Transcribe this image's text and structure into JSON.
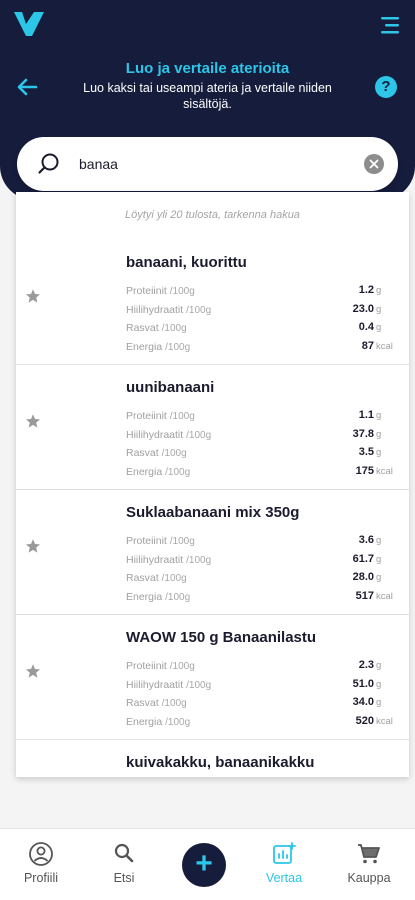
{
  "header": {
    "title": "Luo ja vertaile aterioita",
    "subtitle": "Luo kaksi tai useampi ateria ja vertaile niiden sisältöjä.",
    "help_label": "?"
  },
  "search": {
    "value": "banaa",
    "hint": "Löytyi yli 20 tulosta, tarkenna hakua"
  },
  "nutrient_labels": {
    "protein": "Proteiinit",
    "carbs": "Hiilihydraatit",
    "fat": "Rasvat",
    "energy": "Energia",
    "per": "/100g"
  },
  "results": [
    {
      "name": "banaani, kuorittu",
      "protein": "1.2",
      "carbs": "23.0",
      "fat": "0.4",
      "energy": "87"
    },
    {
      "name": "uunibanaani",
      "protein": "1.1",
      "carbs": "37.8",
      "fat": "3.5",
      "energy": "175"
    },
    {
      "name": "Suklaabanaani mix 350g",
      "protein": "3.6",
      "carbs": "61.7",
      "fat": "28.0",
      "energy": "517"
    },
    {
      "name": "WAOW 150 g Banaanilastu",
      "protein": "2.3",
      "carbs": "51.0",
      "fat": "34.0",
      "energy": "520"
    },
    {
      "name": "kuivakakku, banaanikakku",
      "protein": "",
      "carbs": "",
      "fat": "",
      "energy": ""
    }
  ],
  "units": {
    "g": "g",
    "kcal": "kcal"
  },
  "bottom_nav": [
    {
      "label": "Profiili",
      "icon": "profile-icon"
    },
    {
      "label": "Etsi",
      "icon": "search-icon"
    },
    {
      "label": "+",
      "icon": "add-icon"
    },
    {
      "label": "Vertaa",
      "icon": "compare-icon"
    },
    {
      "label": "Kauppa",
      "icon": "cart-icon"
    }
  ],
  "colors": {
    "navy": "#161c3c",
    "accent": "#2cc6e9"
  }
}
